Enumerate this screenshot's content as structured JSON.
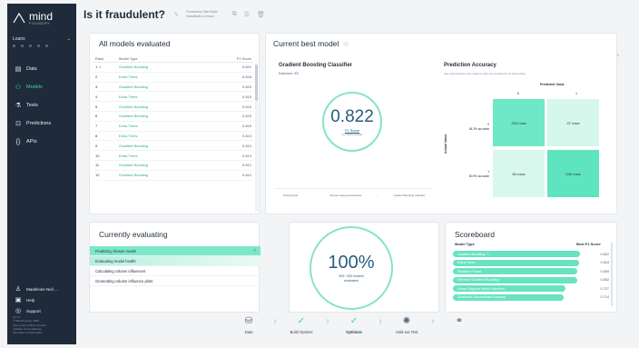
{
  "brand": {
    "name": "mind",
    "sub": "FOUNDRY"
  },
  "sidebar": {
    "user_label": "Loans",
    "nav": [
      {
        "label": "Data",
        "icon": "table-icon",
        "glyph": "▤",
        "active": false
      },
      {
        "label": "Models",
        "icon": "models-icon",
        "glyph": "⚇",
        "active": true
      },
      {
        "label": "Tests",
        "icon": "flask-icon",
        "glyph": "⚗",
        "active": false
      },
      {
        "label": "Predictions",
        "icon": "predictions-icon",
        "glyph": "⊡",
        "active": false
      },
      {
        "label": "APIs",
        "icon": "api-icon",
        "glyph": "{}",
        "active": false
      }
    ],
    "bottom": [
      {
        "label": "Madeleine Neil ...",
        "icon": "user-icon",
        "glyph": "♙"
      },
      {
        "label": "Help",
        "icon": "help-icon",
        "glyph": "▣"
      },
      {
        "label": "Support",
        "icon": "support-icon",
        "glyph": "◎"
      }
    ],
    "version_lines": [
      "v1.7.0",
      "© Mind Foundry 2020",
      "Use is part of Mind Foundry",
      "software & international",
      "Innovation Limited 2019"
    ]
  },
  "header": {
    "title": "Is it fraudulent?",
    "meta_line1": "Fraudulency Data Model",
    "meta_line2": "Classification of fraud"
  },
  "all_models": {
    "title": "All models evaluated",
    "headers": {
      "rank": "Rank",
      "type": "Model Type",
      "score": "F1 Score"
    },
    "rows": [
      {
        "rank": "1 ☆",
        "type": "Gradient Boosting",
        "score": "0.822"
      },
      {
        "rank": "2",
        "type": "Extra Trees",
        "score": "0.818"
      },
      {
        "rank": "3",
        "type": "Gradient Boosting",
        "score": "0.815"
      },
      {
        "rank": "4",
        "type": "Extra Trees",
        "score": "0.815"
      },
      {
        "rank": "5",
        "type": "Gradient Boosting",
        "score": "0.815"
      },
      {
        "rank": "6",
        "type": "Gradient Boosting",
        "score": "0.815"
      },
      {
        "rank": "7",
        "type": "Extra Trees",
        "score": "0.815"
      },
      {
        "rank": "8",
        "type": "Extra Trees",
        "score": "0.813"
      },
      {
        "rank": "9",
        "type": "Gradient Boosting",
        "score": "0.813"
      },
      {
        "rank": "10",
        "type": "Extra Trees",
        "score": "0.813"
      },
      {
        "rank": "11",
        "type": "Gradient Boosting",
        "score": "0.812"
      },
      {
        "rank": "12",
        "type": "Gradient Boosting",
        "score": "0.810"
      }
    ]
  },
  "best_model": {
    "title": "Current best model",
    "name": "Gradient Boosting Classifier",
    "estimators": "Estimators: 302",
    "score": "0.822",
    "score_label": "F1 Score",
    "score_sub": "(on training data)",
    "pipeline": [
      "Training Data",
      "Encode categorical features",
      "Gradient Boosting Classifier"
    ]
  },
  "prediction_accuracy": {
    "title": "Prediction Accuracy",
    "subtitle": "See what prediction was made for each row compared to its actual value",
    "predicted_label": "Predicted Value",
    "actual_label": "Actual Value",
    "cols": [
      "0",
      "1"
    ],
    "row0_label": "0",
    "row0_sub": "84.3% accurate",
    "row1_label": "1",
    "row1_sub": "80.9% accurate",
    "cells": [
      "253 rows",
      "47 rows",
      "60 rows",
      "240 rows"
    ]
  },
  "evaluating": {
    "title": "Currently evaluating",
    "steps": [
      "Finalizing chosen model",
      "Evaluating model health",
      "Calculating column influences",
      "Generating column influence plots"
    ]
  },
  "progress": {
    "percent_text": "100%",
    "percent": 100,
    "line1": "300 / 300 models",
    "line2": "evaluated"
  },
  "scoreboard": {
    "title": "Scoreboard",
    "col_type": "Model Type",
    "col_score": "Best F1 Score",
    "rows": [
      {
        "label": "Gradient Boosting ☆",
        "score": "0.822",
        "value": 0.822
      },
      {
        "label": "Extra Trees",
        "score": "0.818",
        "value": 0.818
      },
      {
        "label": "Random Forest",
        "score": "0.805",
        "value": 0.805
      },
      {
        "label": "Extreme Gradient Boosting",
        "score": "0.802",
        "value": 0.802
      },
      {
        "label": "Linear Support Vector Machine",
        "score": "0.727",
        "value": 0.727
      },
      {
        "label": "Quadratic Discriminant Analysis",
        "score": "0.714",
        "value": 0.714
      }
    ]
  },
  "stepper": [
    {
      "label": "Data",
      "icon": "database-icon",
      "glyph": "⛁",
      "done": false,
      "bold": false
    },
    {
      "label": "Build Options",
      "icon": "check-icon",
      "glyph": "✓",
      "done": true,
      "bold": false
    },
    {
      "label": "Optimize",
      "icon": "check-icon",
      "glyph": "✓",
      "done": true,
      "bold": true
    },
    {
      "label": "Hold-out Test",
      "icon": "sparkle-icon",
      "glyph": "✺",
      "done": false,
      "bold": false
    },
    {
      "label": "",
      "icon": "share-icon",
      "glyph": "⚭",
      "done": false,
      "bold": false
    }
  ],
  "colors": {
    "accent": "#48d1a8",
    "sidebar": "#1f2b3a",
    "bar": "#68e3c0",
    "ring": "#86e3c6"
  }
}
